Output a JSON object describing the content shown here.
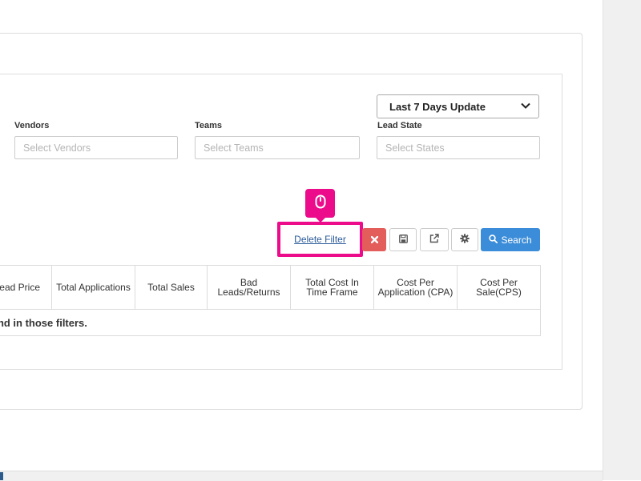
{
  "filters": {
    "date_range": {
      "selected": "Last 7 Days Update"
    },
    "vendors": {
      "label": "Vendors",
      "placeholder": "Select Vendors"
    },
    "teams": {
      "label": "Teams",
      "placeholder": "Select Teams"
    },
    "lead_state": {
      "label": "Lead State",
      "placeholder": "Select States"
    }
  },
  "toolbar": {
    "delete_filter_label": "Delete Filter",
    "clear_icon": "times-icon",
    "save_icon": "floppy-disk-icon",
    "export_icon": "external-link-icon",
    "settings_icon": "gear-icon",
    "search_label": "Search",
    "search_icon": "search-icon"
  },
  "tooltip": {
    "icon": "mouse-icon",
    "color": "#ec0b8a"
  },
  "table": {
    "columns": [
      "ead Price",
      "Total Applications",
      "Total Sales",
      "Bad Leads/Returns",
      "Total Cost In Time Frame",
      "Cost Per Application (CPA)",
      "Cost Per Sale(CPS)"
    ],
    "empty_message": "und in those filters."
  },
  "colors": {
    "highlight": "#ec0b8a",
    "danger": "#e35d5b",
    "primary": "#3c8dd9",
    "link": "#2a5b9a"
  }
}
